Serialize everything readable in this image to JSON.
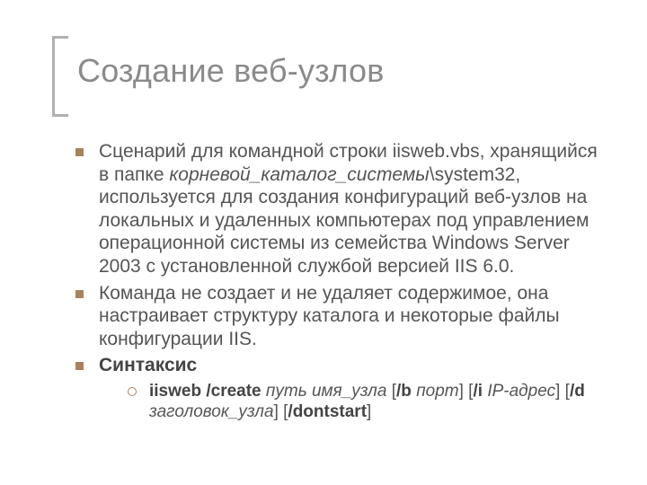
{
  "title": "Создание веб-узлов",
  "bullets": [
    {
      "segments": [
        {
          "t": "Сценарий для командной строки iisweb.vbs, хранящийся в папке "
        },
        {
          "t": "корневой_каталог_системы",
          "i": true
        },
        {
          "t": "\\system32, используется для создания конфигураций веб-узлов на локальных и удаленных компьютерах под управлением операционной системы из семейства Windows Server 2003 с установленной службой версией IIS 6.0."
        }
      ]
    },
    {
      "segments": [
        {
          "t": "Команда не создает и не удаляет содержимое, она настраивает структуру каталога и некоторые файлы конфигурации IIS."
        }
      ]
    },
    {
      "segments": [
        {
          "t": "Синтаксис",
          "b": true
        }
      ],
      "sub": [
        {
          "segments": [
            {
              "t": "iisweb /create ",
              "b": true
            },
            {
              "t": "путь имя_узла",
              "i": true
            },
            {
              "t": " ["
            },
            {
              "t": "/b",
              "b": true
            },
            {
              "t": " "
            },
            {
              "t": "порт",
              "i": true
            },
            {
              "t": "] ["
            },
            {
              "t": "/i",
              "b": true
            },
            {
              "t": " "
            },
            {
              "t": "IP-адрес",
              "i": true
            },
            {
              "t": "] ["
            },
            {
              "t": "/d",
              "b": true
            },
            {
              "t": " "
            },
            {
              "t": "заголовок_узла",
              "i": true
            },
            {
              "t": "] ["
            },
            {
              "t": "/dontstart",
              "b": true
            },
            {
              "t": "]"
            }
          ]
        }
      ]
    }
  ]
}
